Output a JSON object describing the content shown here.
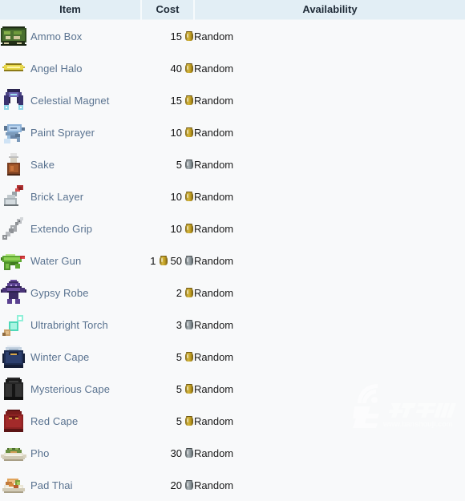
{
  "table": {
    "headers": {
      "item": "Item",
      "cost": "Cost",
      "availability": "Availability"
    },
    "rows": [
      {
        "icon": "ammo-box-icon",
        "name": "Ammo Box",
        "gold": "",
        "silver": "15",
        "availability": "Random"
      },
      {
        "icon": "angel-halo-icon",
        "name": "Angel Halo",
        "gold": "",
        "silver": "40",
        "availability": "Random"
      },
      {
        "icon": "celestial-magnet-icon",
        "name": "Celestial Magnet",
        "gold": "",
        "silver": "15",
        "availability": "Random"
      },
      {
        "icon": "paint-sprayer-icon",
        "name": "Paint Sprayer",
        "gold": "",
        "silver": "10",
        "availability": "Random"
      },
      {
        "icon": "sake-icon",
        "name": "Sake",
        "gold": "",
        "silver": "5",
        "availability": "Random"
      },
      {
        "icon": "brick-layer-icon",
        "name": "Brick Layer",
        "gold": "",
        "silver": "10",
        "availability": "Random"
      },
      {
        "icon": "extendo-grip-icon",
        "name": "Extendo Grip",
        "gold": "",
        "silver": "10",
        "availability": "Random"
      },
      {
        "icon": "water-gun-icon",
        "name": "Water Gun",
        "gold": "1",
        "silver": "50",
        "availability": "Random"
      },
      {
        "icon": "gypsy-robe-icon",
        "name": "Gypsy Robe",
        "gold": "",
        "silver": "2",
        "availability": "Random"
      },
      {
        "icon": "ultrabright-torch-icon",
        "name": "Ultrabright Torch",
        "gold": "",
        "silver": "3",
        "availability": "Random"
      },
      {
        "icon": "winter-cape-icon",
        "name": "Winter Cape",
        "gold": "",
        "silver": "5",
        "availability": "Random"
      },
      {
        "icon": "mysterious-cape-icon",
        "name": "Mysterious Cape",
        "gold": "",
        "silver": "5",
        "availability": "Random"
      },
      {
        "icon": "red-cape-icon",
        "name": "Red Cape",
        "gold": "",
        "silver": "5",
        "availability": "Random"
      },
      {
        "icon": "pho-icon",
        "name": "Pho",
        "gold": "",
        "silver": "30",
        "availability": "Random"
      },
      {
        "icon": "pad-thai-icon",
        "name": "Pad Thai",
        "gold": "",
        "silver": "20",
        "availability": "Random"
      }
    ]
  },
  "coin_types": {
    "ammo-box-icon": "silver",
    "angel-halo-icon": "silver",
    "celestial-magnet-icon": "silver",
    "paint-sprayer-icon": "gold",
    "sake-icon": "silver",
    "brick-layer-icon": "gold",
    "extendo-grip-icon": "gold",
    "water-gun-icon": "mixed",
    "gypsy-robe-icon": "gold",
    "ultrabright-torch-icon": "silver",
    "winter-cape-icon": "gold",
    "mysterious-cape-icon": "gold",
    "red-cape-icon": "gold",
    "pho-icon": "silver",
    "pad-thai-icon": "silver"
  },
  "row_coin_metal": [
    "gold",
    "gold",
    "gold",
    "gold",
    "silver",
    "gold",
    "gold",
    "mixed",
    "gold",
    "silver",
    "gold",
    "gold",
    "gold",
    "silver",
    "silver"
  ],
  "watermark": {
    "text": "www.banshouji.com",
    "logo": "watermark-logo"
  },
  "colors": {
    "header_bg": "#e2eef5",
    "header_text": "#202c39",
    "row_bg": "#f8f9fa",
    "link": "#5a7390",
    "body_text": "#151515",
    "coin_gold": "#c9a82c",
    "coin_silver": "#99a3a7"
  }
}
